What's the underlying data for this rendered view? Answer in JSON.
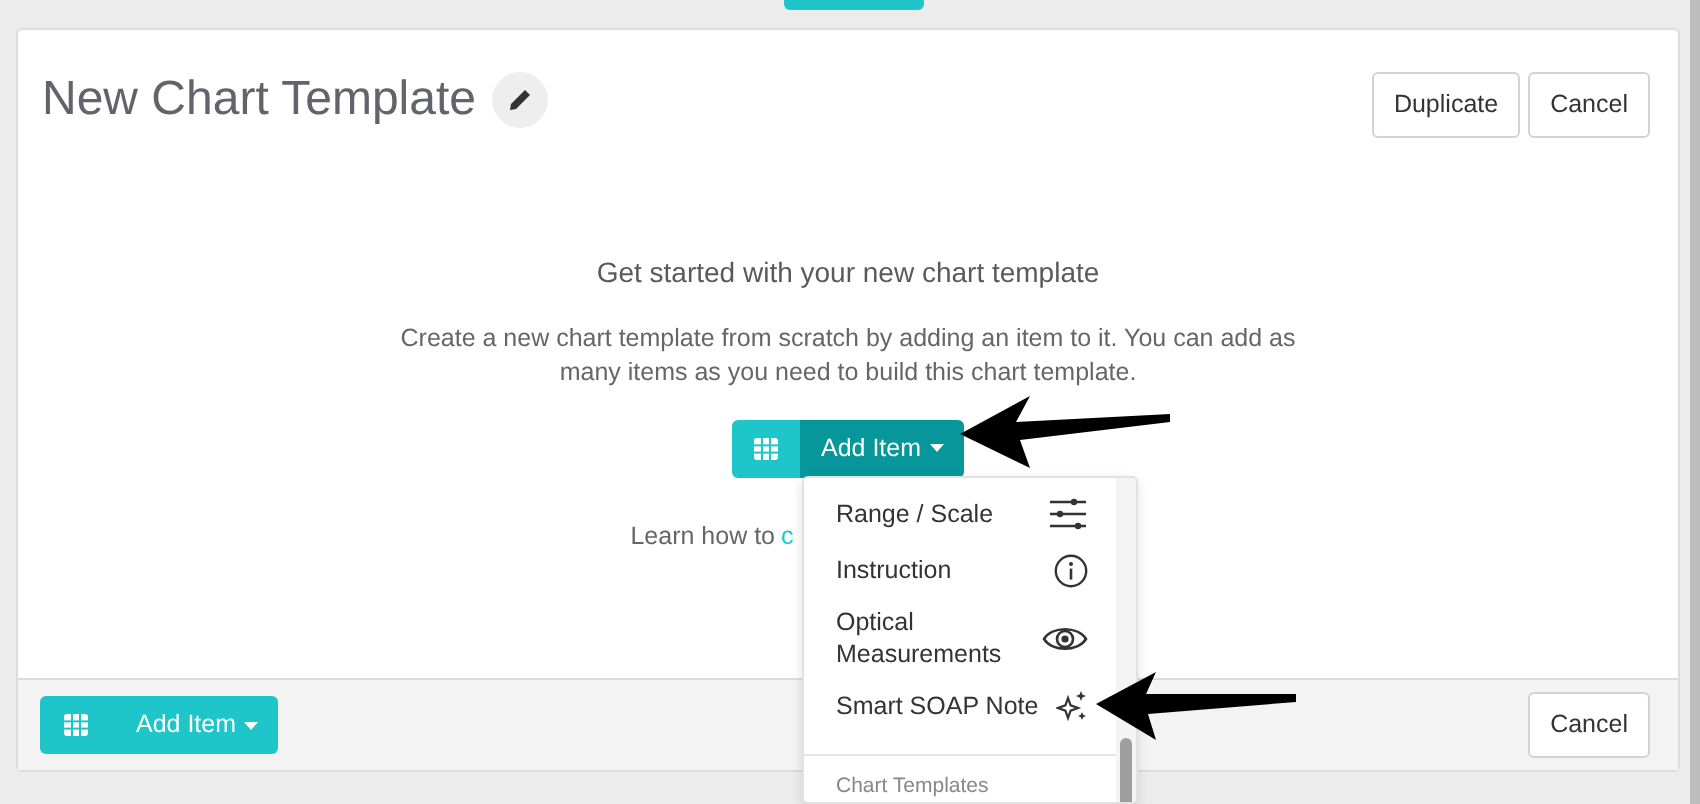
{
  "title": "New Chart Template",
  "header_buttons": [
    "Duplicate",
    "Cancel"
  ],
  "empty_state": {
    "heading": "Get started with your new chart template",
    "description": "Create a new chart template from scratch by adding an item to it. You can add as many items as you need to build this chart template.",
    "add_button": "Add Item",
    "learn_text": "Learn how to",
    "learn_link": "c"
  },
  "dropdown": {
    "items": [
      {
        "label": "Range / Scale",
        "kind": "range"
      },
      {
        "label": "Instruction",
        "kind": "info"
      },
      {
        "label": "Optical Measurements",
        "kind": "eye"
      },
      {
        "label": "Smart SOAP Note",
        "kind": "sparkle"
      }
    ],
    "section_header": "Chart Templates"
  },
  "footer": {
    "add_button": "Add Item",
    "cancel_button": "Cancel"
  }
}
